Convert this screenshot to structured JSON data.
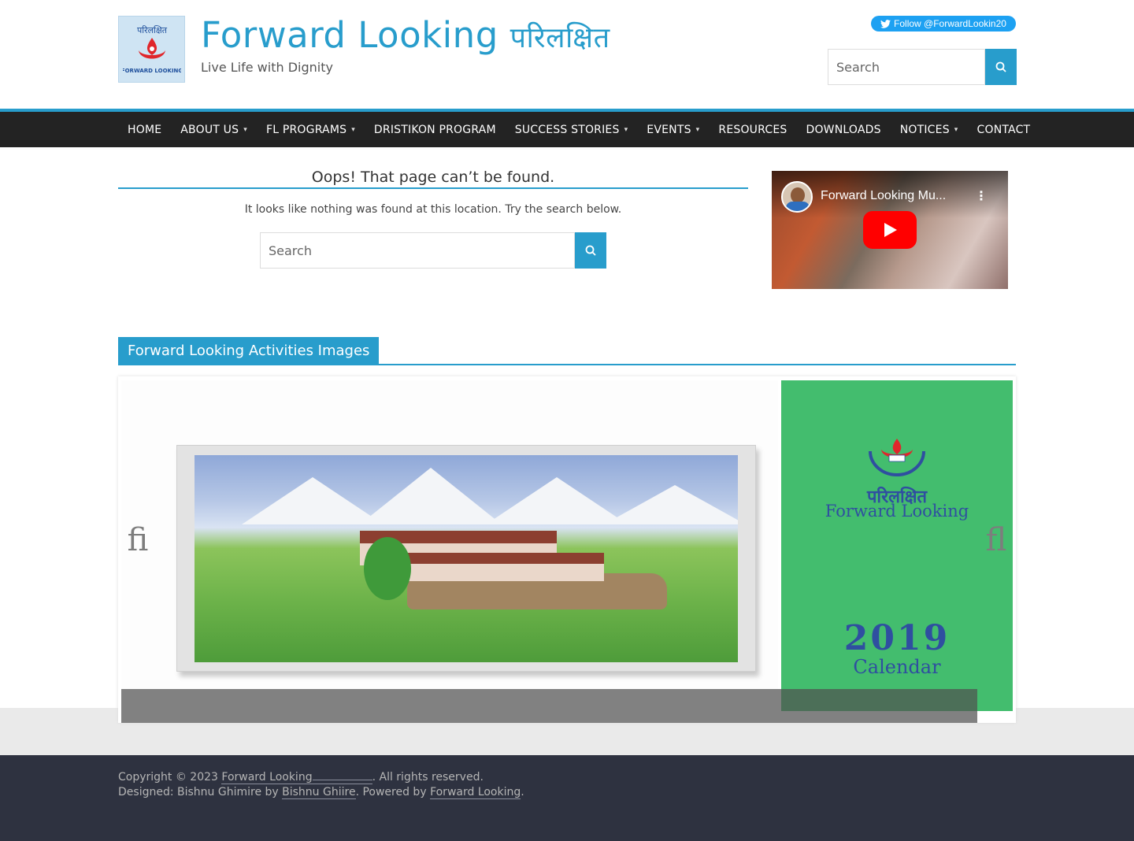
{
  "site": {
    "title": "Forward Looking",
    "title_nepali": "परिलक्षित",
    "tagline": "Live Life with Dignity"
  },
  "twitter": {
    "label": "Follow @ForwardLookin20"
  },
  "search": {
    "placeholder": "Search"
  },
  "nav": [
    {
      "label": "HOME",
      "has_dropdown": false
    },
    {
      "label": "ABOUT US",
      "has_dropdown": true
    },
    {
      "label": "FL PROGRAMS",
      "has_dropdown": true
    },
    {
      "label": "DRISTIKON PROGRAM",
      "has_dropdown": false
    },
    {
      "label": "SUCCESS STORIES",
      "has_dropdown": true
    },
    {
      "label": "EVENTS",
      "has_dropdown": true
    },
    {
      "label": "RESOURCES",
      "has_dropdown": false
    },
    {
      "label": "DOWNLOADS",
      "has_dropdown": false
    },
    {
      "label": "NOTICES",
      "has_dropdown": true
    },
    {
      "label": "CONTACT",
      "has_dropdown": false
    }
  ],
  "not_found": {
    "title": "Oops! That page can’t be found.",
    "message": "It looks like nothing was found at this location. Try the search below."
  },
  "video": {
    "title": "Forward Looking Mu..."
  },
  "activities": {
    "heading": "Forward Looking Activities Images",
    "slide2": {
      "nepali": "परिलक्षित",
      "brand": "Forward Looking",
      "year": "2019",
      "label": "Calendar"
    },
    "prev_glyph": "ﬁ",
    "next_glyph": "ﬂ"
  },
  "footer": {
    "copyright_prefix": "Copyright © 2023",
    "copyright_link": "Forward Looking",
    "copyright_suffix": ". All rights reserved.",
    "designed_prefix": "Designed: Bishnu Ghimire by",
    "designer_link": "Bishnu Ghiire",
    "powered_prefix": ". Powered by",
    "powered_link": "Forward Looking",
    "powered_suffix": "."
  },
  "colors": {
    "accent": "#289dcc",
    "nav_bg": "#232323",
    "footer_bg": "#2e3240",
    "calendar_green": "#43bd6e",
    "youtube_red": "#ff0000"
  }
}
